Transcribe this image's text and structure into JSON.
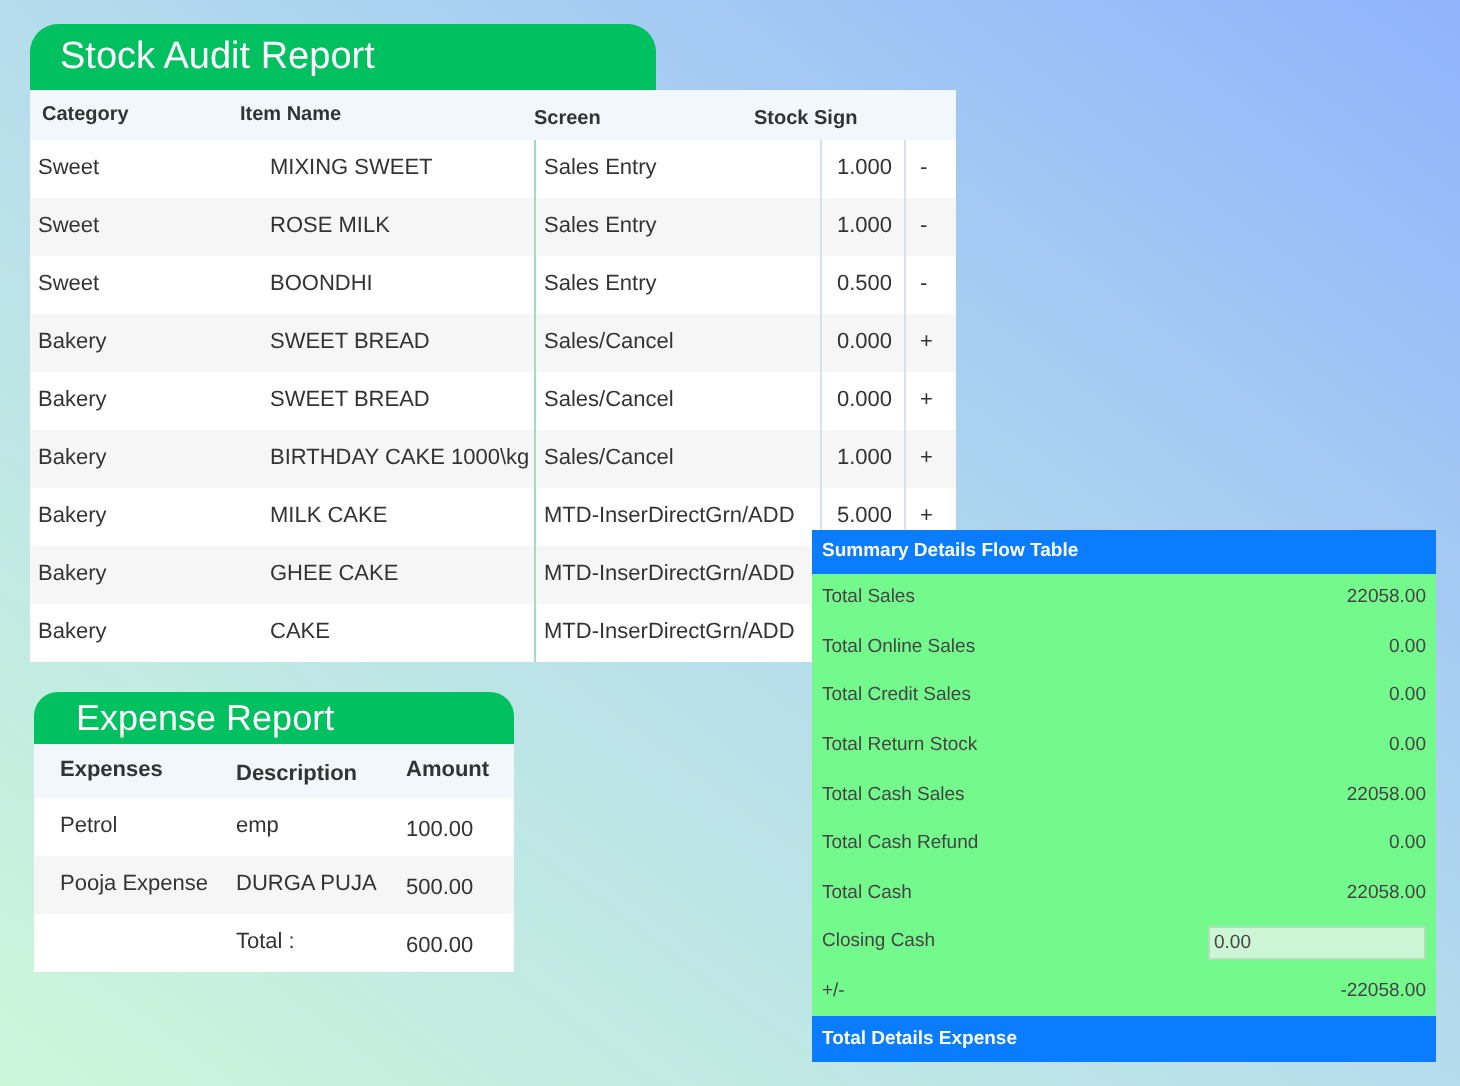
{
  "stock_audit": {
    "title": "Stock Audit Report",
    "columns": [
      "Category",
      "Item Name",
      "Screen",
      "Stock Sign"
    ],
    "rows": [
      {
        "category": "Sweet",
        "item": "MIXING SWEET",
        "screen": "Sales Entry",
        "qty": "1.000",
        "sign": "-"
      },
      {
        "category": "Sweet",
        "item": "ROSE MILK",
        "screen": "Sales Entry",
        "qty": "1.000",
        "sign": "-"
      },
      {
        "category": "Sweet",
        "item": "BOONDHI",
        "screen": "Sales Entry",
        "qty": "0.500",
        "sign": "-"
      },
      {
        "category": "Bakery",
        "item": "SWEET BREAD",
        "screen": "Sales/Cancel",
        "qty": "0.000",
        "sign": "+"
      },
      {
        "category": "Bakery",
        "item": "SWEET BREAD",
        "screen": "Sales/Cancel",
        "qty": "0.000",
        "sign": "+"
      },
      {
        "category": "Bakery",
        "item": "BIRTHDAY CAKE 1000\\kg",
        "screen": "Sales/Cancel",
        "qty": "1.000",
        "sign": "+"
      },
      {
        "category": "Bakery",
        "item": "MILK CAKE",
        "screen": "MTD-InserDirectGrn/ADD",
        "qty": "5.000",
        "sign": "+"
      },
      {
        "category": "Bakery",
        "item": "GHEE CAKE",
        "screen": "MTD-InserDirectGrn/ADD"
      },
      {
        "category": "Bakery",
        "item": "CAKE",
        "screen": "MTD-InserDirectGrn/ADD"
      }
    ]
  },
  "expense_report": {
    "title": "Expense Report",
    "columns": [
      "Expenses",
      "Description",
      "Amount"
    ],
    "rows": [
      {
        "expense": "Petrol",
        "description": "emp",
        "amount": "100.00"
      },
      {
        "expense": "Pooja Expense",
        "description": "DURGA PUJA",
        "amount": "500.00"
      },
      {
        "description": "Total :",
        "amount": "600.00"
      }
    ]
  },
  "summary": {
    "title": "Summary Details Flow Table",
    "rows": [
      {
        "kind": "value",
        "label": "Total Sales",
        "value": "22058.00"
      },
      {
        "kind": "value",
        "label": "Total Online Sales",
        "value": "0.00"
      },
      {
        "kind": "value",
        "label": "Total Credit Sales",
        "value": "0.00"
      },
      {
        "kind": "value",
        "label": "Total Return Stock",
        "value": "0.00"
      },
      {
        "kind": "value",
        "label": "Total Cash Sales",
        "value": "22058.00"
      },
      {
        "kind": "value",
        "label": "Total Cash Refund",
        "value": "0.00"
      },
      {
        "kind": "value",
        "label": "Total Cash",
        "value": "22058.00"
      },
      {
        "kind": "input",
        "label": "Closing Cash",
        "value": "0.00"
      },
      {
        "kind": "value",
        "label": "+/-",
        "value": "-22058.00"
      }
    ],
    "footer": "Total Details Expense"
  }
}
